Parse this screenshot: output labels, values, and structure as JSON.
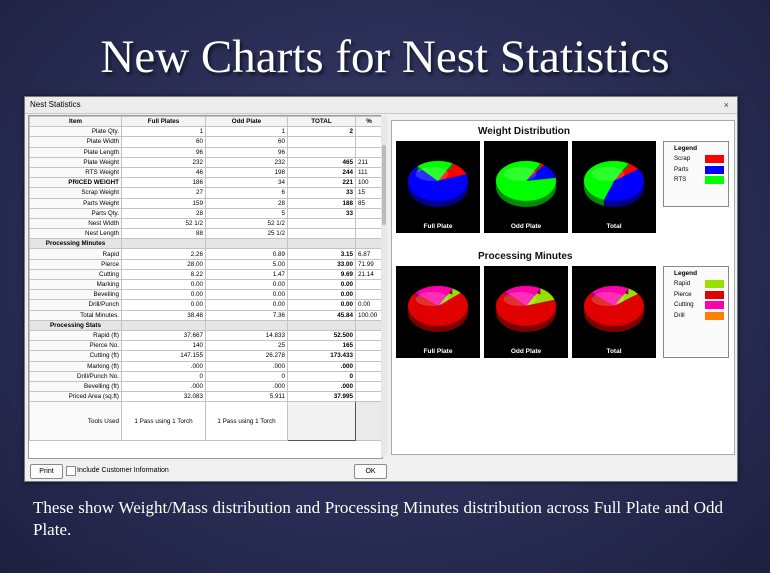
{
  "slide": {
    "title": "New Charts for Nest Statistics",
    "caption": "These show Weight/Mass distribution and Processing Minutes distribution across Full Plate and Odd Plate."
  },
  "window": {
    "title": "Nest Statistics",
    "close_glyph": "×"
  },
  "table": {
    "headers": [
      "Item",
      "Full Plates",
      "Odd Plate",
      "TOTAL",
      "%"
    ],
    "rows": [
      {
        "type": "row",
        "label": "Plate Qty.",
        "full": "1",
        "odd": "1",
        "total": "2",
        "pct": ""
      },
      {
        "type": "row",
        "label": "Plate Width",
        "full": "60",
        "odd": "60",
        "total": "",
        "pct": ""
      },
      {
        "type": "row",
        "label": "Plate Length",
        "full": "96",
        "odd": "96",
        "total": "",
        "pct": ""
      },
      {
        "type": "row",
        "label": "Plate Weight",
        "full": "232",
        "odd": "232",
        "total": "465",
        "pct": "211"
      },
      {
        "type": "row",
        "label": "RTS Weight",
        "full": "46",
        "odd": "198",
        "total": "244",
        "pct": "111"
      },
      {
        "type": "row",
        "label": "PRICED WEIGHT",
        "full": "186",
        "odd": "34",
        "total": "221",
        "pct": "100",
        "bold": true
      },
      {
        "type": "row",
        "label": "Scrap Weight",
        "full": "27",
        "odd": "6",
        "total": "33",
        "pct": "15"
      },
      {
        "type": "row",
        "label": "Parts Weight",
        "full": "159",
        "odd": "28",
        "total": "188",
        "pct": "85"
      },
      {
        "type": "row",
        "label": "Parts Qty.",
        "full": "28",
        "odd": "5",
        "total": "33",
        "pct": ""
      },
      {
        "type": "row",
        "label": "Nest Width",
        "full": "52 1/2",
        "odd": "52 1/2",
        "total": "",
        "pct": ""
      },
      {
        "type": "row",
        "label": "Nest Length",
        "full": "88",
        "odd": "25 1/2",
        "total": "",
        "pct": ""
      },
      {
        "type": "section",
        "label": "Processing Minutes"
      },
      {
        "type": "row",
        "label": "Rapid",
        "full": "2.26",
        "odd": "0.89",
        "total": "3.15",
        "pct": "6.87"
      },
      {
        "type": "row",
        "label": "Pierce",
        "full": "28.00",
        "odd": "5.00",
        "total": "33.00",
        "pct": "71.99"
      },
      {
        "type": "row",
        "label": "Cutting",
        "full": "8.22",
        "odd": "1.47",
        "total": "9.69",
        "pct": "21.14"
      },
      {
        "type": "row",
        "label": "Marking",
        "full": "0.00",
        "odd": "0.00",
        "total": "0.00",
        "pct": ""
      },
      {
        "type": "row",
        "label": "Bevelling",
        "full": "0.00",
        "odd": "0.00",
        "total": "0.00",
        "pct": ""
      },
      {
        "type": "row",
        "label": "Drill/Punch",
        "full": "0.00",
        "odd": "0.00",
        "total": "0.00",
        "pct": "0.00"
      },
      {
        "type": "row",
        "label": "Total Minutes.",
        "full": "38.48",
        "odd": "7.36",
        "total": "45.84",
        "pct": "100.00"
      },
      {
        "type": "section",
        "label": "Processing Stats"
      },
      {
        "type": "row",
        "label": "Rapid (ft)",
        "full": "37.667",
        "odd": "14.833",
        "total": "52.500",
        "pct": ""
      },
      {
        "type": "row",
        "label": "Pierce No.",
        "full": "140",
        "odd": "25",
        "total": "165",
        "pct": ""
      },
      {
        "type": "row",
        "label": "Cutting (ft)",
        "full": "147.155",
        "odd": "26.278",
        "total": "173.433",
        "pct": ""
      },
      {
        "type": "row",
        "label": "Marking (ft)",
        "full": ".000",
        "odd": ".000",
        "total": ".000",
        "pct": ""
      },
      {
        "type": "row",
        "label": "Drill/Punch No.",
        "full": "0",
        "odd": "0",
        "total": "0",
        "pct": ""
      },
      {
        "type": "row",
        "label": "Bevelling (ft)",
        "full": ".000",
        "odd": ".000",
        "total": ".000",
        "pct": ""
      },
      {
        "type": "row",
        "label": "Priced Area (sq.ft)",
        "full": "32.083",
        "odd": "5.911",
        "total": "37.995",
        "pct": ""
      },
      {
        "type": "tools",
        "label": "Tools Used",
        "full": "1 Pass using 1 Torch",
        "odd": "1 Pass using 1 Torch"
      }
    ]
  },
  "charts": {
    "weight": {
      "title": "Weight Distribution",
      "legend_title": "Legend",
      "legend": [
        {
          "name": "Scrap",
          "color": "#ff0000"
        },
        {
          "name": "Parts",
          "color": "#0000ff"
        },
        {
          "name": "RTS",
          "color": "#00ff00"
        }
      ],
      "pies": [
        {
          "label": "Full Plate",
          "values": [
            27,
            159,
            46
          ]
        },
        {
          "label": "Odd Plate",
          "values": [
            6,
            28,
            198
          ]
        },
        {
          "label": "Total",
          "values": [
            33,
            188,
            244
          ]
        }
      ]
    },
    "minutes": {
      "title": "Processing Minutes",
      "legend_title": "Legend",
      "legend": [
        {
          "name": "Rapid",
          "color": "#99e000"
        },
        {
          "name": "Pierce",
          "color": "#e00000"
        },
        {
          "name": "Cutting",
          "color": "#ff00aa"
        },
        {
          "name": "Drill",
          "color": "#ff8000"
        }
      ],
      "pies": [
        {
          "label": "Full Plate",
          "values": [
            2.26,
            28.0,
            8.22,
            0
          ]
        },
        {
          "label": "Odd Plate",
          "values": [
            0.89,
            5.0,
            1.47,
            0
          ]
        },
        {
          "label": "Total",
          "values": [
            3.15,
            33.0,
            9.69,
            0
          ]
        }
      ]
    }
  },
  "footer": {
    "print_label": "Print",
    "checkbox_label": "Include Customer Information",
    "checkbox_checked": false,
    "ok_label": "OK"
  }
}
